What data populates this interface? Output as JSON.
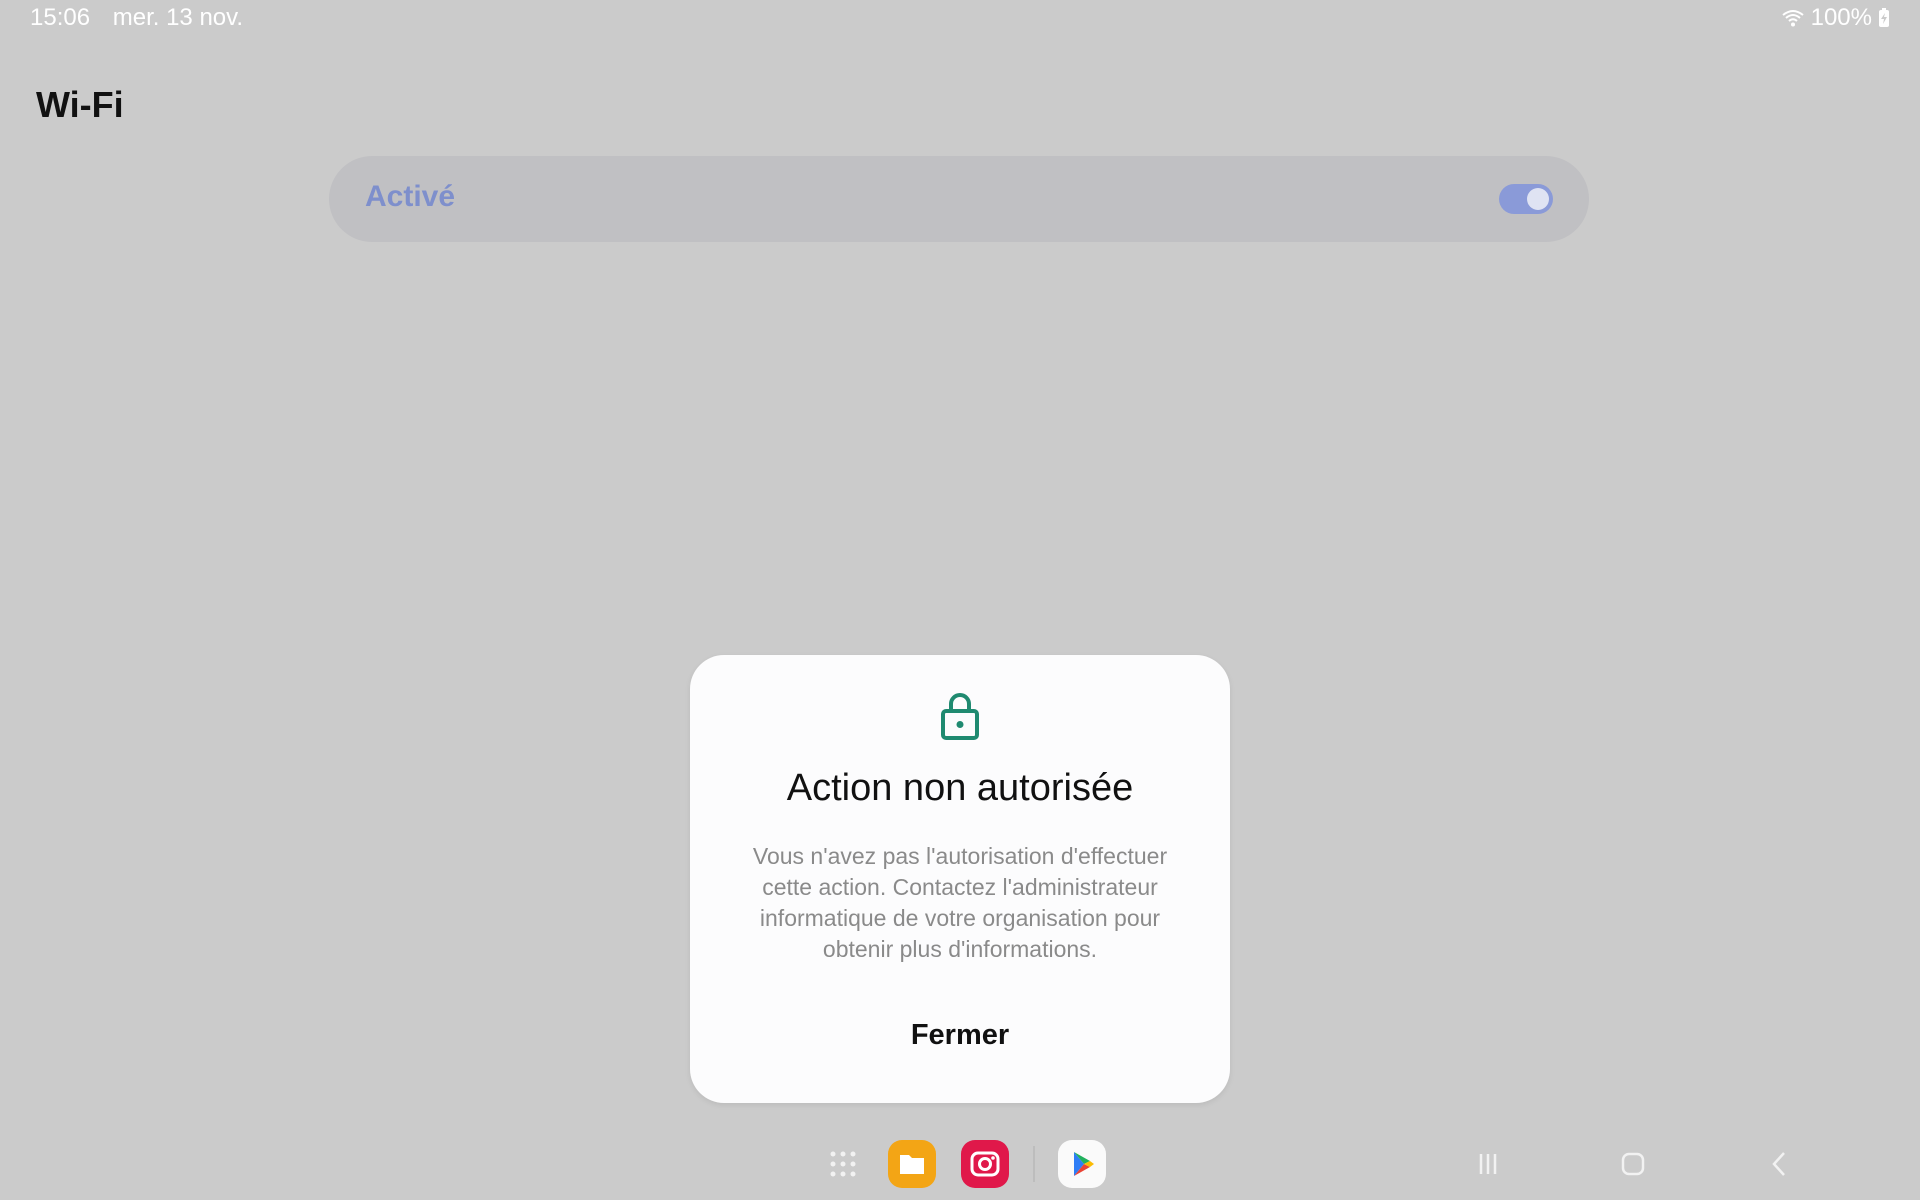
{
  "status_bar": {
    "time": "15:06",
    "date": "mer. 13 nov.",
    "battery": "100%",
    "icons": [
      "wifi-icon",
      "battery-charging-icon"
    ]
  },
  "page": {
    "title": "Wi-Fi"
  },
  "wifi_toggle": {
    "label": "Activé",
    "state": "on",
    "accent": "#7e8fcc"
  },
  "dialog": {
    "icon": "lock-icon",
    "icon_color": "#1f8a70",
    "title": "Action non autorisée",
    "message": "Vous n'avez pas l'autorisation d'effectuer cette action. Contactez l'administrateur informatique de votre organisation pour obtenir plus d'informations.",
    "button": "Fermer"
  },
  "taskbar": {
    "apps": [
      "apps-grid-icon",
      "my-files-icon",
      "camera-icon",
      "play-store-icon"
    ]
  },
  "navigation": {
    "buttons": [
      "recent-apps-icon",
      "home-icon",
      "back-icon"
    ]
  }
}
